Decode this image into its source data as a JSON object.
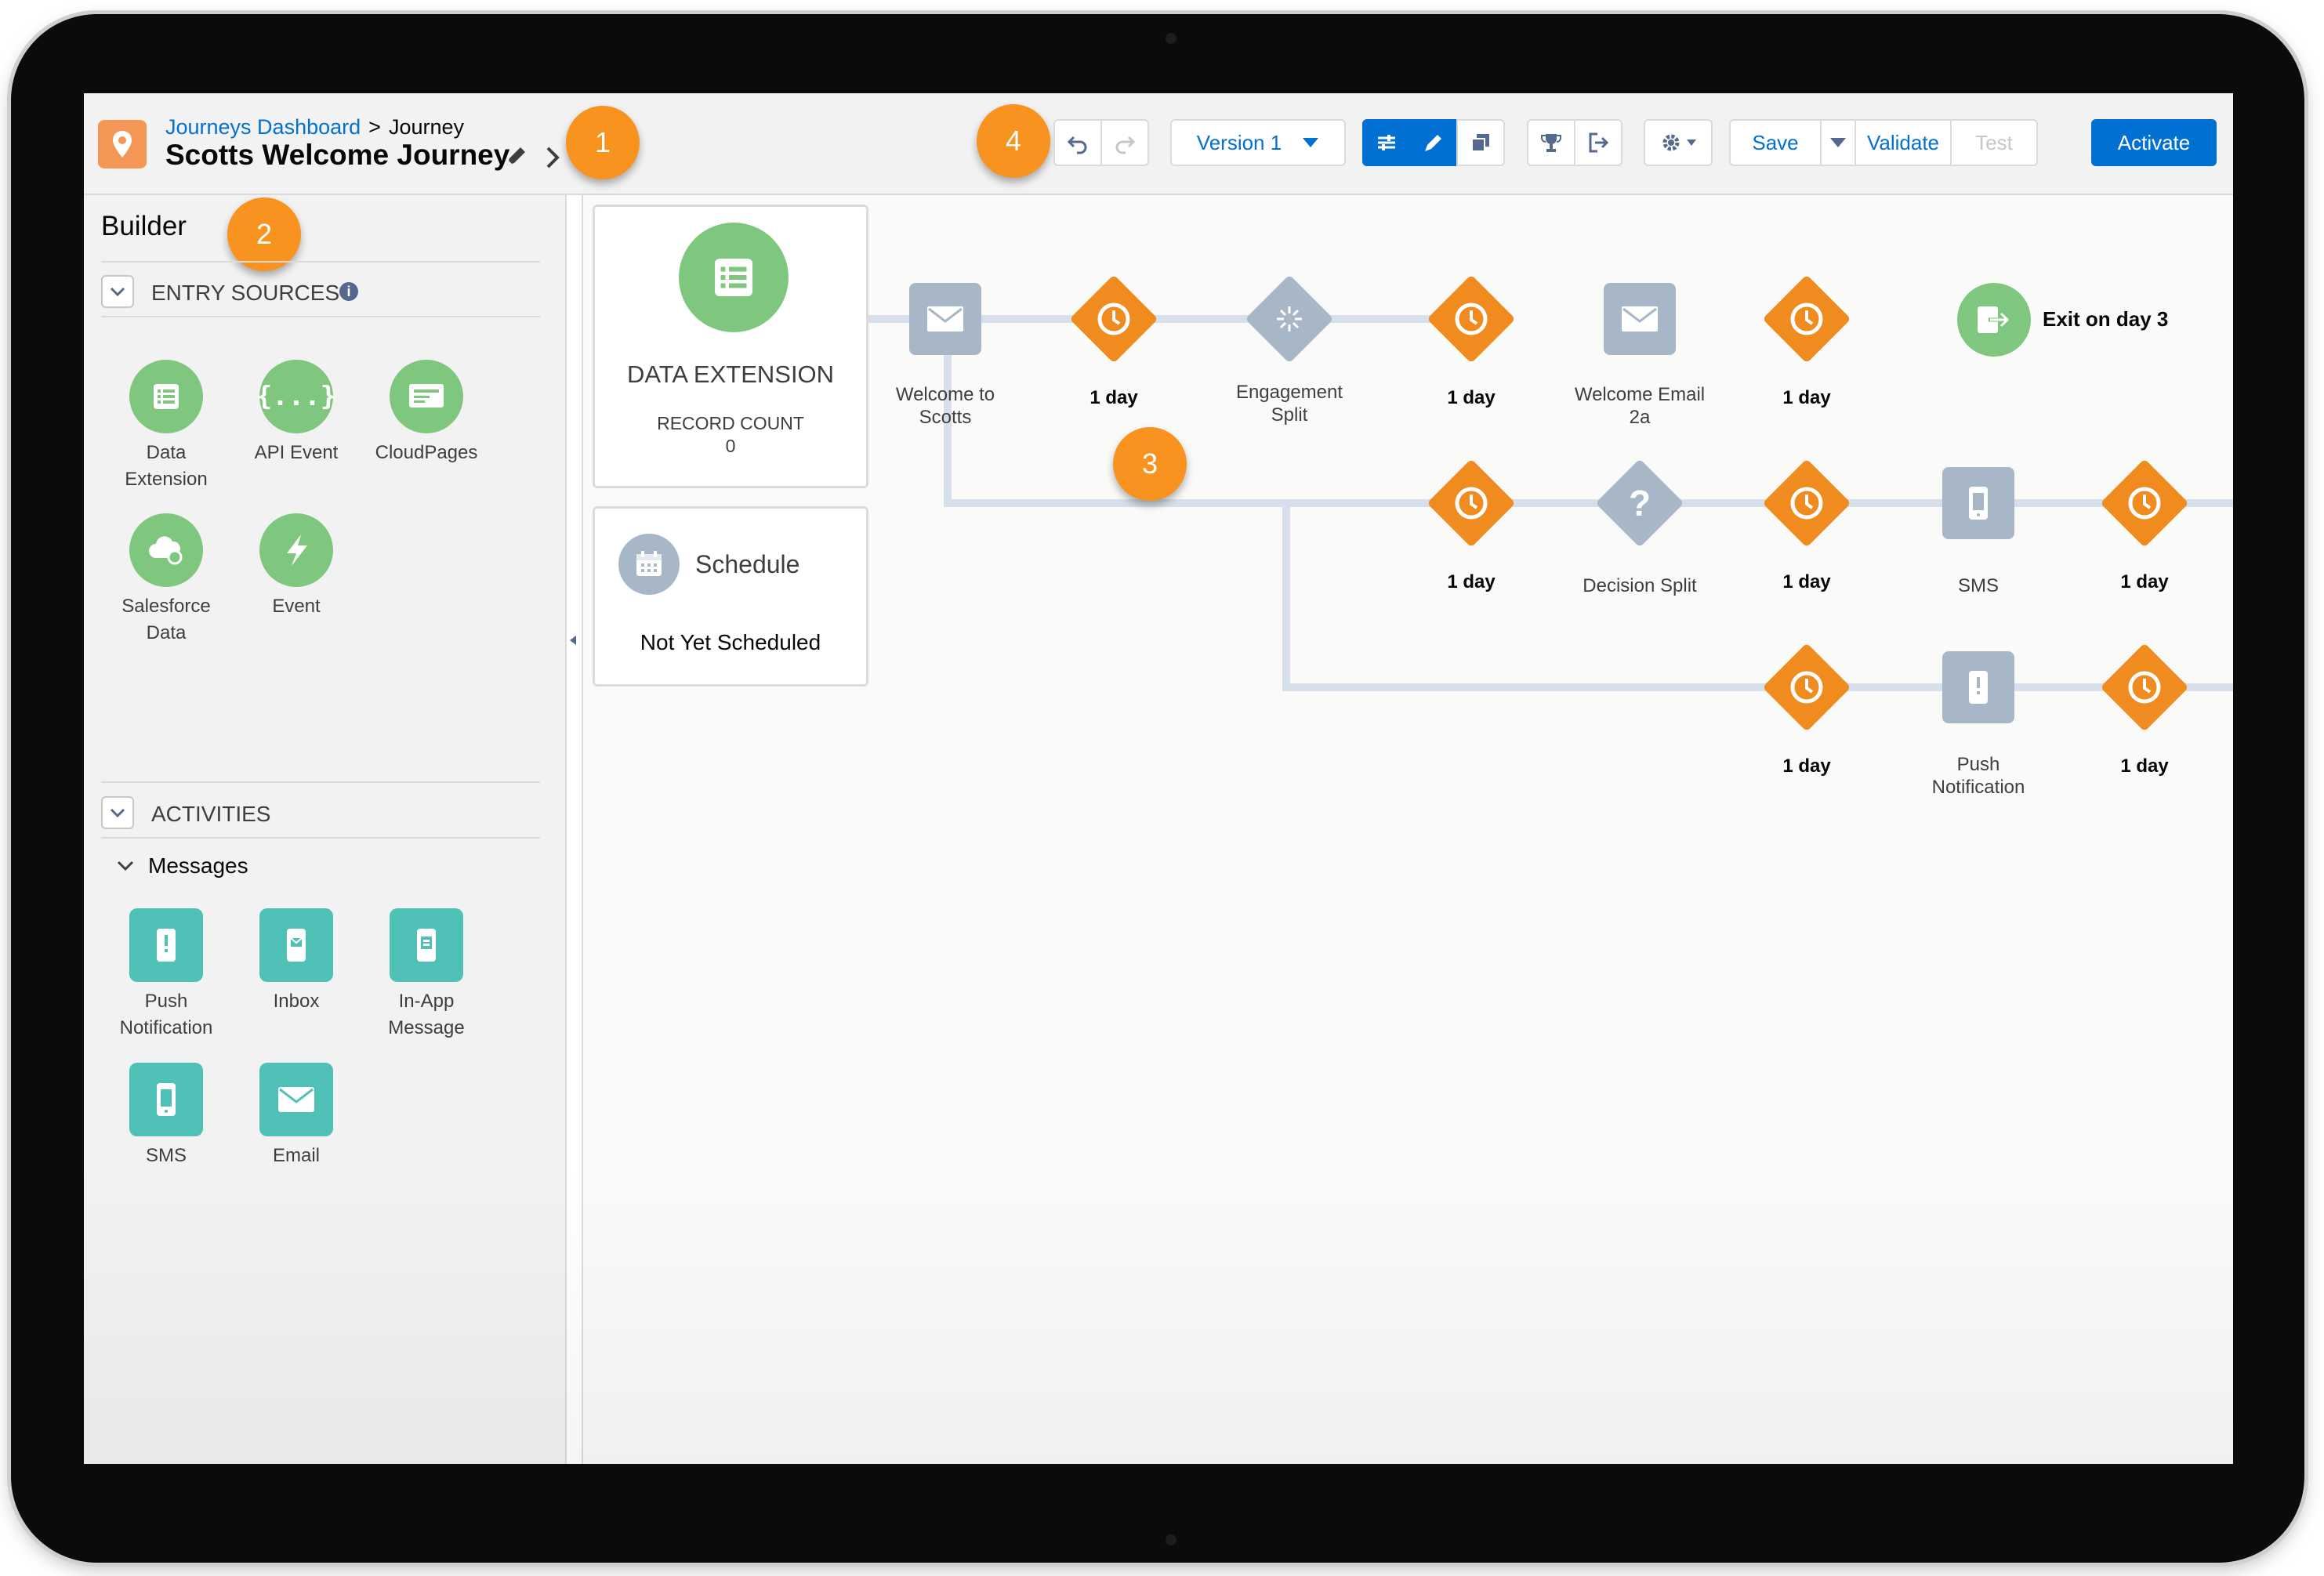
{
  "header": {
    "breadcrumb_link": "Journeys Dashboard",
    "breadcrumb_sep": ">",
    "breadcrumb_current": "Journey",
    "journey_name": "Scotts Welcome Journey"
  },
  "toolbar": {
    "version_label": "Version 1",
    "save_label": "Save",
    "validate_label": "Validate",
    "test_label": "Test",
    "activate_label": "Activate"
  },
  "callouts": {
    "one": "1",
    "two": "2",
    "three": "3",
    "four": "4"
  },
  "sidebar": {
    "title": "Builder",
    "entry_sources_label": "ENTRY SOURCES",
    "entry_sources": [
      {
        "label_line1": "Data",
        "label_line2": "Extension",
        "icon": "data-extension-icon"
      },
      {
        "label_line1": "API Event",
        "label_line2": "",
        "icon": "api-event-icon"
      },
      {
        "label_line1": "CloudPages",
        "label_line2": "",
        "icon": "cloudpages-icon"
      },
      {
        "label_line1": "Salesforce",
        "label_line2": "Data",
        "icon": "salesforce-data-icon"
      },
      {
        "label_line1": "Event",
        "label_line2": "",
        "icon": "event-icon"
      }
    ],
    "activities_label": "ACTIVITIES",
    "messages_label": "Messages",
    "messages": [
      {
        "label_line1": "Push",
        "label_line2": "Notification",
        "icon": "push-notification-icon"
      },
      {
        "label_line1": "Inbox",
        "label_line2": "",
        "icon": "inbox-icon"
      },
      {
        "label_line1": "In-App",
        "label_line2": "Message",
        "icon": "in-app-message-icon"
      },
      {
        "label_line1": "SMS",
        "label_line2": "",
        "icon": "sms-icon"
      },
      {
        "label_line1": "Email",
        "label_line2": "",
        "icon": "email-icon"
      }
    ]
  },
  "canvas": {
    "entry_card": {
      "title": "DATA EXTENSION",
      "record_count_label": "RECORD COUNT",
      "record_count": "0"
    },
    "schedule_card": {
      "title": "Schedule",
      "status": "Not Yet Scheduled"
    },
    "nodes": {
      "welcome_to_scotts": {
        "line1": "Welcome to",
        "line2": "Scotts"
      },
      "engagement_split": {
        "line1": "Engagement",
        "line2": "Split"
      },
      "welcome_email_2a": {
        "line1": "Welcome Email",
        "line2": "2a"
      },
      "exit": "Exit on day 3",
      "decision_split": "Decision Split",
      "sms": "SMS",
      "push_notification": {
        "line1": "Push",
        "line2": "Notification"
      }
    },
    "wait_label": "1 day"
  },
  "colors": {
    "accent": "#0070d2",
    "wait_orange": "#f08c1f",
    "callout_orange": "#f7931e",
    "entry_green": "#7fc77e",
    "message_teal": "#4fc1b6",
    "node_gray": "#a8b7c7",
    "path_line": "#d7e0ea"
  }
}
